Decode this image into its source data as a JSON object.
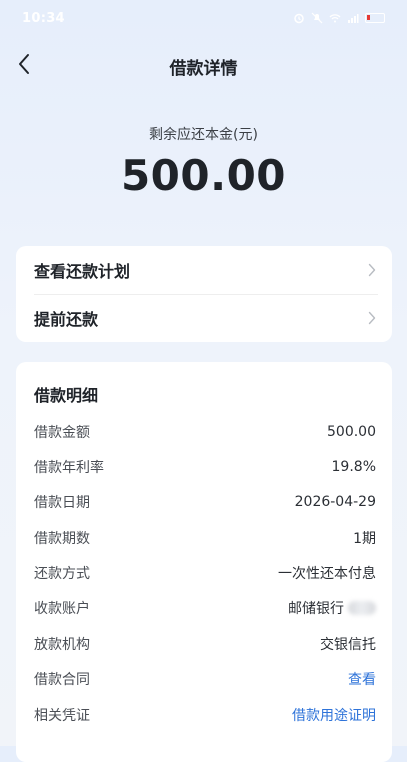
{
  "status_bar": {
    "time": "10:34"
  },
  "nav": {
    "title": "借款详情"
  },
  "summary": {
    "label": "剩余应还本金(元)",
    "amount": "500.00"
  },
  "actions": [
    {
      "label": "查看还款计划"
    },
    {
      "label": "提前还款"
    }
  ],
  "details": {
    "title": "借款明细",
    "rows": [
      {
        "key": "借款金额",
        "value": "500.00"
      },
      {
        "key": "借款年利率",
        "value": "19.8%"
      },
      {
        "key": "借款日期",
        "value": "2026-04-29"
      },
      {
        "key": "借款期数",
        "value": "1期"
      },
      {
        "key": "还款方式",
        "value": "一次性还本付息"
      },
      {
        "key": "收款账户",
        "value": "邮储银行"
      },
      {
        "key": "放款机构",
        "value": "交银信托"
      },
      {
        "key": "借款合同",
        "value": "查看"
      },
      {
        "key": "相关凭证",
        "value": "借款用途证明"
      }
    ]
  },
  "colors": {
    "link": "#2e73d9",
    "background": "#eef3fb",
    "card": "#ffffff"
  }
}
